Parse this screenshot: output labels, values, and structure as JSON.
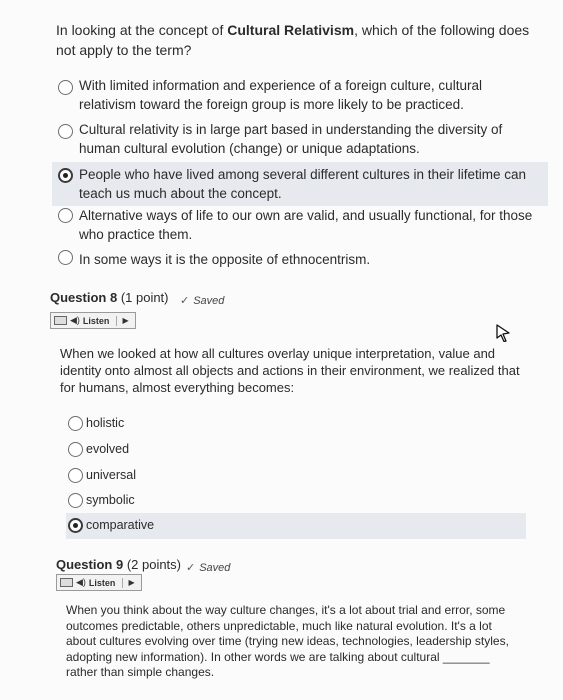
{
  "q7": {
    "prefix": "In looking at the concept of ",
    "term": "Cultural Relativism",
    "suffix": ", which of the following does not apply to the term?",
    "options": [
      {
        "label": "With limited information and experience of a foreign culture, cultural relativism toward the foreign group is more likely to be practiced.",
        "selected": false
      },
      {
        "label": "Cultural relativity is in large part based in understanding the diversity of human cultural evolution (change) or unique adaptations.",
        "selected": false
      },
      {
        "label": "People who have lived among several different cultures in their lifetime can teach us much about the concept.",
        "selected": true
      },
      {
        "label": "Alternative ways of life to our own are valid, and usually functional, for those who practice them.",
        "selected": false
      },
      {
        "label": "In some ways it is the opposite of ethnocentrism.",
        "selected": false
      }
    ]
  },
  "q8": {
    "title": "Question 8",
    "points": "(1 point)",
    "status": "Saved",
    "listen_label": "Listen",
    "text": "When we looked at how all cultures overlay unique interpretation, value and identity onto almost all objects and actions in their environment, we realized that for humans, almost everything becomes:",
    "options": [
      {
        "label": "holistic",
        "selected": false
      },
      {
        "label": "evolved",
        "selected": false
      },
      {
        "label": "universal",
        "selected": false
      },
      {
        "label": "symbolic",
        "selected": false
      },
      {
        "label": "comparative",
        "selected": true
      }
    ]
  },
  "q9": {
    "title": "Question 9",
    "points": "(2 points)",
    "status": "Saved",
    "listen_label": "Listen",
    "text": "When you think about the way culture changes, it's a lot about trial and error, some outcomes predictable, others unpredictable, much like natural evolution.  It's a lot about cultures evolving over time (trying new ideas, technologies, leadership styles, adopting new information).  In other words we are talking about cultural _______ rather than simple changes."
  },
  "colors": {
    "highlight": "#e6e9ee",
    "text": "#2b2b2b"
  }
}
